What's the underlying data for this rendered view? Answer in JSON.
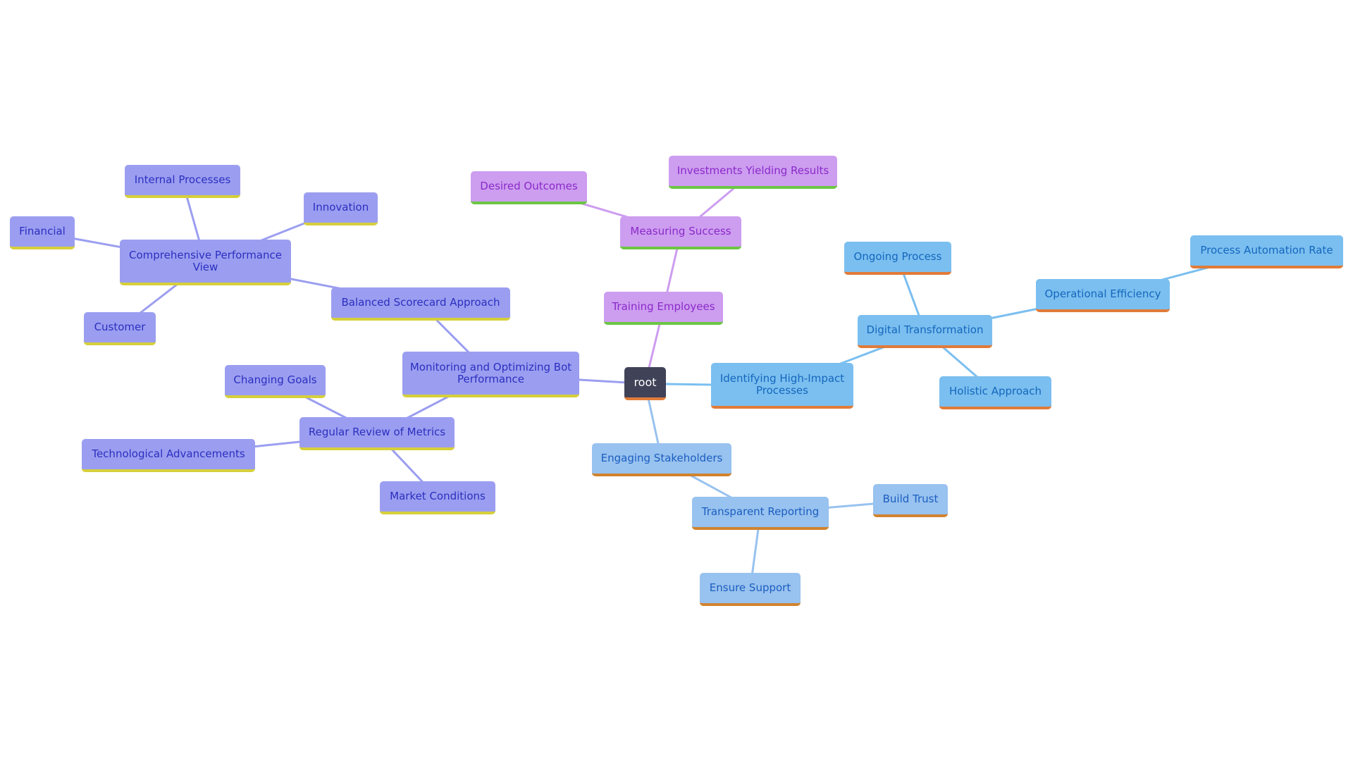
{
  "diagram": {
    "type": "mindmap",
    "root": "root",
    "colors": {
      "root_fill": "#404258",
      "purple_branch": "#9b9ef0",
      "violet_branch": "#cd9df0",
      "blue_branch": "#7bbff0",
      "light_blue_branch": "#98c2ef",
      "purple_underline": "#d6cf3b",
      "violet_underline": "#6cc644",
      "blue_underline": "#e07b39"
    },
    "nodes": {
      "root": "root",
      "monitoring": "Monitoring and Optimizing Bot Performance",
      "balanced": "Balanced Scorecard Approach",
      "comprehensive": "Comprehensive Performance View",
      "financial": "Financial",
      "internal": "Internal Processes",
      "innovation": "Innovation",
      "customer": "Customer",
      "regular": "Regular Review of Metrics",
      "changing": "Changing Goals",
      "tech": "Technological Advancements",
      "market": "Market Conditions",
      "training": "Training Employees",
      "measuring": "Measuring Success",
      "desired": "Desired Outcomes",
      "investments": "Investments Yielding Results",
      "identifying": "Identifying High-Impact Processes",
      "digital": "Digital Transformation",
      "ongoing": "Ongoing Process",
      "operational": "Operational Efficiency",
      "automation": "Process Automation Rate",
      "holistic": "Holistic Approach",
      "engaging": "Engaging Stakeholders",
      "transparent": "Transparent Reporting",
      "trust": "Build Trust",
      "support": "Ensure Support"
    },
    "edges": [
      [
        "root",
        "monitoring"
      ],
      [
        "monitoring",
        "balanced"
      ],
      [
        "balanced",
        "comprehensive"
      ],
      [
        "comprehensive",
        "financial"
      ],
      [
        "comprehensive",
        "internal"
      ],
      [
        "comprehensive",
        "innovation"
      ],
      [
        "comprehensive",
        "customer"
      ],
      [
        "monitoring",
        "regular"
      ],
      [
        "regular",
        "changing"
      ],
      [
        "regular",
        "tech"
      ],
      [
        "regular",
        "market"
      ],
      [
        "root",
        "training"
      ],
      [
        "training",
        "measuring"
      ],
      [
        "measuring",
        "desired"
      ],
      [
        "measuring",
        "investments"
      ],
      [
        "root",
        "identifying"
      ],
      [
        "identifying",
        "digital"
      ],
      [
        "digital",
        "ongoing"
      ],
      [
        "digital",
        "operational"
      ],
      [
        "operational",
        "automation"
      ],
      [
        "digital",
        "holistic"
      ],
      [
        "root",
        "engaging"
      ],
      [
        "engaging",
        "transparent"
      ],
      [
        "transparent",
        "trust"
      ],
      [
        "transparent",
        "support"
      ]
    ]
  }
}
